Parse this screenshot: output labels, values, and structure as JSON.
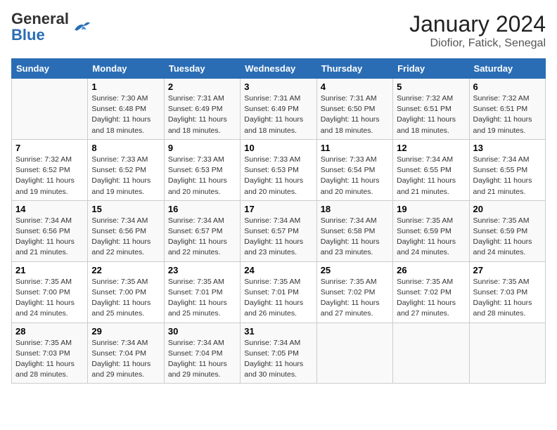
{
  "header": {
    "logo_general": "General",
    "logo_blue": "Blue",
    "title": "January 2024",
    "location": "Diofior, Fatick, Senegal"
  },
  "days_of_week": [
    "Sunday",
    "Monday",
    "Tuesday",
    "Wednesday",
    "Thursday",
    "Friday",
    "Saturday"
  ],
  "weeks": [
    [
      {
        "day": "",
        "info": ""
      },
      {
        "day": "1",
        "info": "Sunrise: 7:30 AM\nSunset: 6:48 PM\nDaylight: 11 hours\nand 18 minutes."
      },
      {
        "day": "2",
        "info": "Sunrise: 7:31 AM\nSunset: 6:49 PM\nDaylight: 11 hours\nand 18 minutes."
      },
      {
        "day": "3",
        "info": "Sunrise: 7:31 AM\nSunset: 6:49 PM\nDaylight: 11 hours\nand 18 minutes."
      },
      {
        "day": "4",
        "info": "Sunrise: 7:31 AM\nSunset: 6:50 PM\nDaylight: 11 hours\nand 18 minutes."
      },
      {
        "day": "5",
        "info": "Sunrise: 7:32 AM\nSunset: 6:51 PM\nDaylight: 11 hours\nand 18 minutes."
      },
      {
        "day": "6",
        "info": "Sunrise: 7:32 AM\nSunset: 6:51 PM\nDaylight: 11 hours\nand 19 minutes."
      }
    ],
    [
      {
        "day": "7",
        "info": "Sunrise: 7:32 AM\nSunset: 6:52 PM\nDaylight: 11 hours\nand 19 minutes."
      },
      {
        "day": "8",
        "info": "Sunrise: 7:33 AM\nSunset: 6:52 PM\nDaylight: 11 hours\nand 19 minutes."
      },
      {
        "day": "9",
        "info": "Sunrise: 7:33 AM\nSunset: 6:53 PM\nDaylight: 11 hours\nand 20 minutes."
      },
      {
        "day": "10",
        "info": "Sunrise: 7:33 AM\nSunset: 6:53 PM\nDaylight: 11 hours\nand 20 minutes."
      },
      {
        "day": "11",
        "info": "Sunrise: 7:33 AM\nSunset: 6:54 PM\nDaylight: 11 hours\nand 20 minutes."
      },
      {
        "day": "12",
        "info": "Sunrise: 7:34 AM\nSunset: 6:55 PM\nDaylight: 11 hours\nand 21 minutes."
      },
      {
        "day": "13",
        "info": "Sunrise: 7:34 AM\nSunset: 6:55 PM\nDaylight: 11 hours\nand 21 minutes."
      }
    ],
    [
      {
        "day": "14",
        "info": "Sunrise: 7:34 AM\nSunset: 6:56 PM\nDaylight: 11 hours\nand 21 minutes."
      },
      {
        "day": "15",
        "info": "Sunrise: 7:34 AM\nSunset: 6:56 PM\nDaylight: 11 hours\nand 22 minutes."
      },
      {
        "day": "16",
        "info": "Sunrise: 7:34 AM\nSunset: 6:57 PM\nDaylight: 11 hours\nand 22 minutes."
      },
      {
        "day": "17",
        "info": "Sunrise: 7:34 AM\nSunset: 6:57 PM\nDaylight: 11 hours\nand 23 minutes."
      },
      {
        "day": "18",
        "info": "Sunrise: 7:34 AM\nSunset: 6:58 PM\nDaylight: 11 hours\nand 23 minutes."
      },
      {
        "day": "19",
        "info": "Sunrise: 7:35 AM\nSunset: 6:59 PM\nDaylight: 11 hours\nand 24 minutes."
      },
      {
        "day": "20",
        "info": "Sunrise: 7:35 AM\nSunset: 6:59 PM\nDaylight: 11 hours\nand 24 minutes."
      }
    ],
    [
      {
        "day": "21",
        "info": "Sunrise: 7:35 AM\nSunset: 7:00 PM\nDaylight: 11 hours\nand 24 minutes."
      },
      {
        "day": "22",
        "info": "Sunrise: 7:35 AM\nSunset: 7:00 PM\nDaylight: 11 hours\nand 25 minutes."
      },
      {
        "day": "23",
        "info": "Sunrise: 7:35 AM\nSunset: 7:01 PM\nDaylight: 11 hours\nand 25 minutes."
      },
      {
        "day": "24",
        "info": "Sunrise: 7:35 AM\nSunset: 7:01 PM\nDaylight: 11 hours\nand 26 minutes."
      },
      {
        "day": "25",
        "info": "Sunrise: 7:35 AM\nSunset: 7:02 PM\nDaylight: 11 hours\nand 27 minutes."
      },
      {
        "day": "26",
        "info": "Sunrise: 7:35 AM\nSunset: 7:02 PM\nDaylight: 11 hours\nand 27 minutes."
      },
      {
        "day": "27",
        "info": "Sunrise: 7:35 AM\nSunset: 7:03 PM\nDaylight: 11 hours\nand 28 minutes."
      }
    ],
    [
      {
        "day": "28",
        "info": "Sunrise: 7:35 AM\nSunset: 7:03 PM\nDaylight: 11 hours\nand 28 minutes."
      },
      {
        "day": "29",
        "info": "Sunrise: 7:34 AM\nSunset: 7:04 PM\nDaylight: 11 hours\nand 29 minutes."
      },
      {
        "day": "30",
        "info": "Sunrise: 7:34 AM\nSunset: 7:04 PM\nDaylight: 11 hours\nand 29 minutes."
      },
      {
        "day": "31",
        "info": "Sunrise: 7:34 AM\nSunset: 7:05 PM\nDaylight: 11 hours\nand 30 minutes."
      },
      {
        "day": "",
        "info": ""
      },
      {
        "day": "",
        "info": ""
      },
      {
        "day": "",
        "info": ""
      }
    ]
  ]
}
